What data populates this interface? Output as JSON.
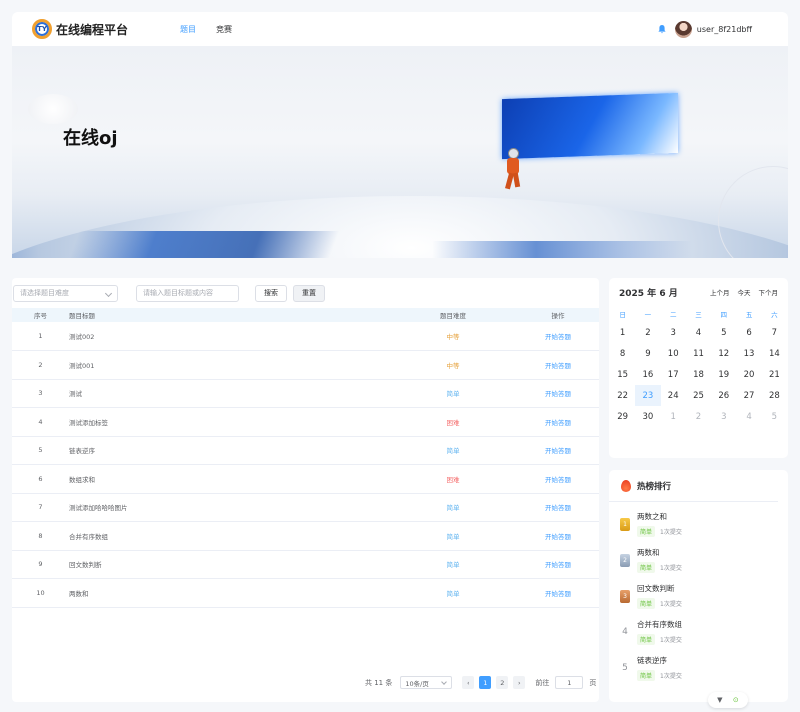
{
  "header": {
    "logo_badge": "TY",
    "logo_text": "在线编程平台",
    "nav": [
      {
        "label": "题目",
        "active": true
      },
      {
        "label": "竞赛",
        "active": false
      }
    ],
    "username": "user_8f21dbff"
  },
  "banner": {
    "title": "在线oj"
  },
  "filters": {
    "difficulty_placeholder": "请选择题目难度",
    "search_placeholder": "请输入题目标题或内容",
    "search_label": "搜索",
    "reset_label": "重置"
  },
  "table": {
    "headers": [
      "序号",
      "题目标题",
      "题目难度",
      "操作"
    ],
    "rows": [
      {
        "no": "1",
        "title": "测试002",
        "difficulty": "中等",
        "level": "mid",
        "action": "开始答题"
      },
      {
        "no": "2",
        "title": "测试001",
        "difficulty": "中等",
        "level": "mid",
        "action": "开始答题"
      },
      {
        "no": "3",
        "title": "测试",
        "difficulty": "简单",
        "level": "easy",
        "action": "开始答题"
      },
      {
        "no": "4",
        "title": "测试添加标签",
        "difficulty": "困难",
        "level": "hard",
        "action": "开始答题"
      },
      {
        "no": "5",
        "title": "链表逆序",
        "difficulty": "简单",
        "level": "easy",
        "action": "开始答题"
      },
      {
        "no": "6",
        "title": "数组求和",
        "difficulty": "困难",
        "level": "hard",
        "action": "开始答题"
      },
      {
        "no": "7",
        "title": "测试添加哈哈哈图片",
        "difficulty": "简单",
        "level": "easy",
        "action": "开始答题"
      },
      {
        "no": "8",
        "title": "合并有序数组",
        "difficulty": "简单",
        "level": "easy",
        "action": "开始答题"
      },
      {
        "no": "9",
        "title": "回文数判断",
        "difficulty": "简单",
        "level": "easy",
        "action": "开始答题"
      },
      {
        "no": "10",
        "title": "两数和",
        "difficulty": "简单",
        "level": "easy",
        "action": "开始答题"
      }
    ]
  },
  "pagination": {
    "total": "共 11 条",
    "page_size": "10条/页",
    "prev": "‹",
    "pages": [
      "1",
      "2"
    ],
    "current": "1",
    "next": "›",
    "goto_prefix": "前往",
    "goto_value": "1",
    "goto_suffix": "页"
  },
  "calendar": {
    "title": "2025 年 6 月",
    "prev_month": "上个月",
    "today": "今天",
    "next_month": "下个月",
    "weekdays": [
      "日",
      "一",
      "二",
      "三",
      "四",
      "五",
      "六"
    ],
    "days": [
      {
        "d": "1"
      },
      {
        "d": "2"
      },
      {
        "d": "3"
      },
      {
        "d": "4"
      },
      {
        "d": "5"
      },
      {
        "d": "6"
      },
      {
        "d": "7"
      },
      {
        "d": "8"
      },
      {
        "d": "9"
      },
      {
        "d": "10"
      },
      {
        "d": "11"
      },
      {
        "d": "12"
      },
      {
        "d": "13"
      },
      {
        "d": "14"
      },
      {
        "d": "15"
      },
      {
        "d": "16"
      },
      {
        "d": "17"
      },
      {
        "d": "18"
      },
      {
        "d": "19"
      },
      {
        "d": "20"
      },
      {
        "d": "21"
      },
      {
        "d": "22"
      },
      {
        "d": "23",
        "today": true
      },
      {
        "d": "24"
      },
      {
        "d": "25"
      },
      {
        "d": "26"
      },
      {
        "d": "27"
      },
      {
        "d": "28"
      },
      {
        "d": "29"
      },
      {
        "d": "30"
      },
      {
        "d": "1",
        "muted": true
      },
      {
        "d": "2",
        "muted": true
      },
      {
        "d": "3",
        "muted": true
      },
      {
        "d": "4",
        "muted": true
      },
      {
        "d": "5",
        "muted": true
      }
    ]
  },
  "hot": {
    "title": "热榜排行",
    "items": [
      {
        "rank": "1",
        "medal": "m1",
        "name": "两数之和",
        "tag": "简单",
        "submits": "1次提交"
      },
      {
        "rank": "2",
        "medal": "m2",
        "name": "两数和",
        "tag": "简单",
        "submits": "1次提交"
      },
      {
        "rank": "3",
        "medal": "m3",
        "name": "回文数判断",
        "tag": "简单",
        "submits": "1次提交"
      },
      {
        "rank": "4",
        "medal": "",
        "name": "合并有序数组",
        "tag": "简单",
        "submits": "1次提交"
      },
      {
        "rank": "5",
        "medal": "",
        "name": "链表逆序",
        "tag": "简单",
        "submits": "1次提交"
      }
    ]
  },
  "colors": {
    "primary": "#409eff",
    "mid": "#e6a23c",
    "easy": "#5fb3f0",
    "hard": "#f56c6c",
    "tag_green": "#67c23a"
  }
}
